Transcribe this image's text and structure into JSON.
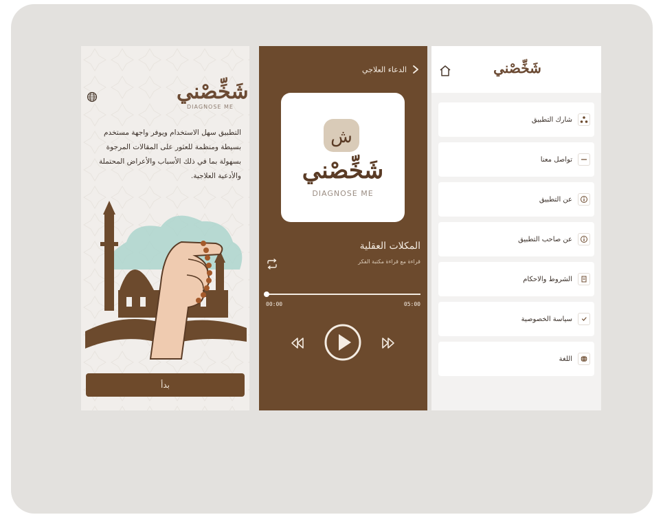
{
  "welcome": {
    "logo_ar": "شَخِّصْني",
    "logo_en": "DIAGNOSE ME",
    "description": "التطبيق سهل الاستخدام ويوفر واجهة مستخدم بسيطة ومنظمة للعثور على المقالات المرجوة بسهولة بما في ذلك الأسباب والأعراض المحتملة والأدعية العلاجية.",
    "start_label": "بدأ",
    "icons": {
      "language": "globe-icon"
    }
  },
  "player": {
    "header_title": "الدعاء العلاجي",
    "art_logo_ar": "شَخِّصْني",
    "art_badge": "ش",
    "art_logo_en": "DIAGNOSE ME",
    "track_title": "المكلات العقلية",
    "track_subtitle": "قراءة مع قراءة مكتبة الفكر",
    "time_current": "00:00",
    "time_total": "05:00",
    "progress": 0.0,
    "icons": {
      "back": "chevron-right-icon",
      "repeat": "repeat-icon",
      "rewind": "rewind-icon",
      "play": "play-icon",
      "forward": "forward-icon"
    }
  },
  "menu": {
    "brand": "شَخِّصْني",
    "items": [
      {
        "label": "شارك التطبيق",
        "icon": "share-icon"
      },
      {
        "label": "تواصل معنا",
        "icon": "mail-icon"
      },
      {
        "label": "عن التطبيق",
        "icon": "info-icon"
      },
      {
        "label": "عن صاحب التطبيق",
        "icon": "info-icon"
      },
      {
        "label": "الشروط والاحكام",
        "icon": "document-icon"
      },
      {
        "label": "سياسة الخصوصية",
        "icon": "shield-check-icon"
      },
      {
        "label": "اللغة",
        "icon": "globe-icon"
      }
    ],
    "icons": {
      "home": "home-icon"
    }
  },
  "colors": {
    "brown": "#6c4a2d",
    "cream": "#f4ece2",
    "frame": "#e3e1de"
  }
}
